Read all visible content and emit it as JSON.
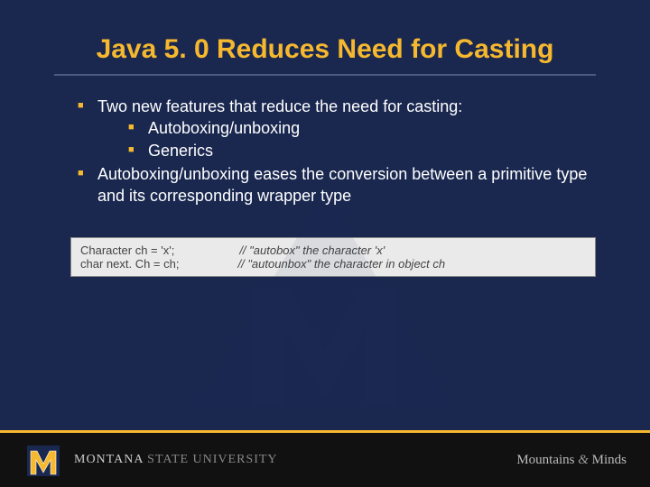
{
  "title": "Java 5. 0 Reduces Need for Casting",
  "bullets": [
    {
      "text": "Two new features that reduce the need for casting:",
      "sub": [
        "Autoboxing/unboxing",
        "Generics"
      ]
    },
    {
      "text": "Autoboxing/unboxing eases the conversion between a primitive type and its corresponding wrapper type"
    }
  ],
  "code": {
    "line1_code": "Character ch = 'x';",
    "line1_comment": "// \"autobox\" the character 'x'",
    "line2_code": "char next. Ch = ch;",
    "line2_comment": "// \"autounbox\" the character in object ch"
  },
  "footer": {
    "university_bold": "MONTANA",
    "university_light": "STATE UNIVERSITY",
    "tagline_left": "Mountains",
    "tagline_amp": "&",
    "tagline_right": "Minds"
  }
}
